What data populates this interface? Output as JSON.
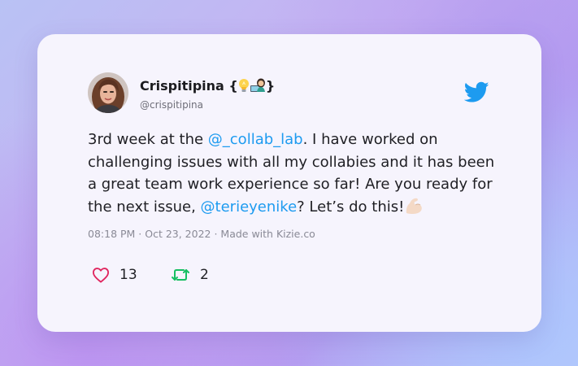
{
  "tweet": {
    "display_name": "Crispitipina",
    "name_brace_open": "{",
    "name_brace_close": "}",
    "username": "@crispitipina",
    "text_1": "3rd week at the ",
    "mention_1": "@_collab_lab",
    "text_2": ". I have worked on challenging issues with all my collabies and it has been a great team work experience so far! Are you ready for the next issue, ",
    "mention_2": "@terieyenike",
    "text_3": "? Let’s do this!",
    "meta": "08:18 PM · Oct 23, 2022 · Made with Kizie.co",
    "likes": "13",
    "retweets": "2",
    "emojis": [
      "light-bulb-emoji",
      "woman-technologist-emoji",
      "flexed-biceps-emoji"
    ]
  },
  "colors": {
    "accent": "#1d9bf0",
    "like": "#e0245e",
    "retweet": "#17bf63",
    "card": "#f6f4fd"
  }
}
